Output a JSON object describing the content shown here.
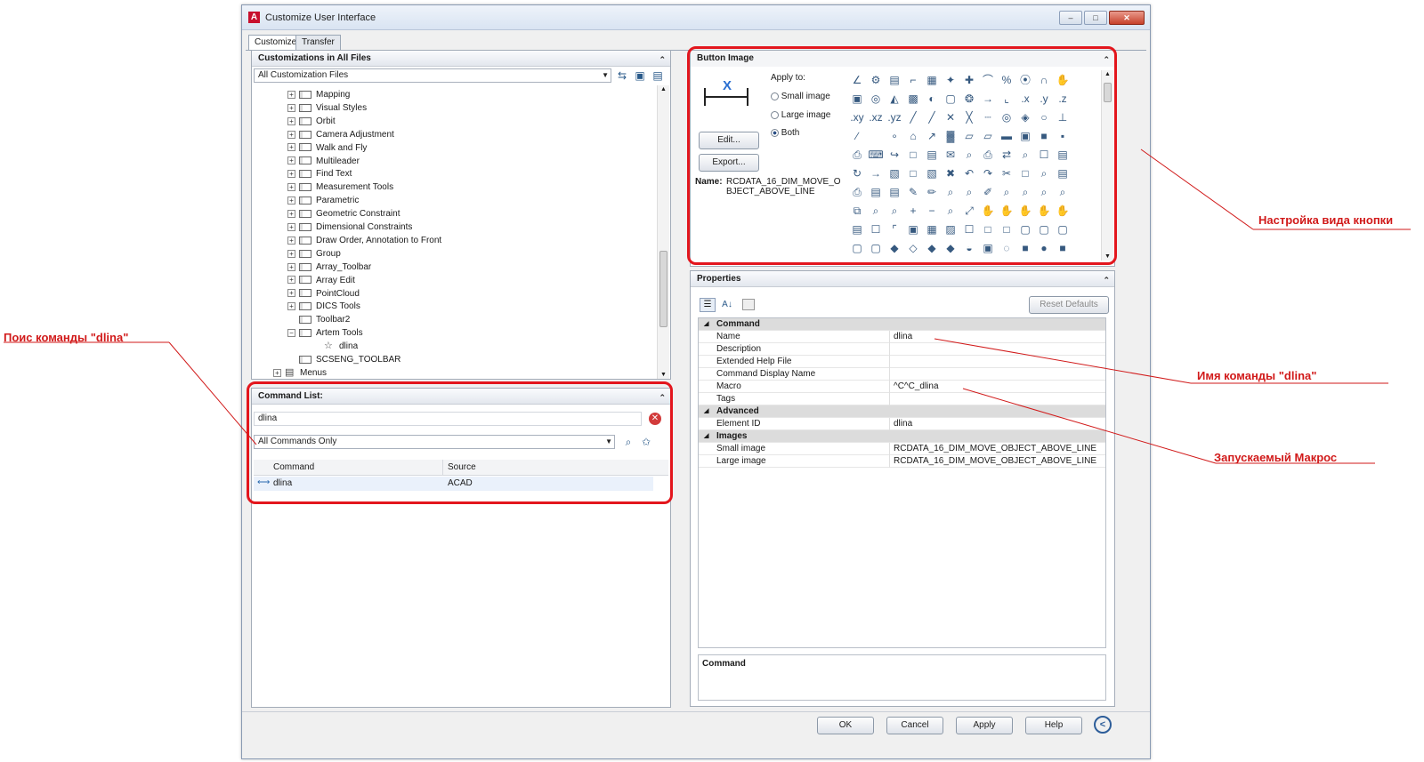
{
  "window": {
    "title": "Customize User Interface",
    "logo": "A",
    "controls": [
      "–",
      "□",
      "✕"
    ]
  },
  "tabs": [
    "Customize",
    "Transfer"
  ],
  "customizations": {
    "header": "Customizations in All Files",
    "file_combo": "All Customization Files",
    "tree": [
      {
        "label": "Mapping",
        "level": 2,
        "expander": "+"
      },
      {
        "label": "Visual Styles",
        "level": 2,
        "expander": "+"
      },
      {
        "label": "Orbit",
        "level": 2,
        "expander": "+"
      },
      {
        "label": "Camera Adjustment",
        "level": 2,
        "expander": "+"
      },
      {
        "label": "Walk and Fly",
        "level": 2,
        "expander": "+"
      },
      {
        "label": "Multileader",
        "level": 2,
        "expander": "+"
      },
      {
        "label": "Find Text",
        "level": 2,
        "expander": "+"
      },
      {
        "label": "Measurement Tools",
        "level": 2,
        "expander": "+"
      },
      {
        "label": "Parametric",
        "level": 2,
        "expander": "+"
      },
      {
        "label": "Geometric Constraint",
        "level": 2,
        "expander": "+"
      },
      {
        "label": "Dimensional Constraints",
        "level": 2,
        "expander": "+"
      },
      {
        "label": "Draw Order, Annotation to Front",
        "level": 2,
        "expander": "+"
      },
      {
        "label": "Group",
        "level": 2,
        "expander": "+"
      },
      {
        "label": "Array_Toolbar",
        "level": 2,
        "expander": "+"
      },
      {
        "label": "Array Edit",
        "level": 2,
        "expander": "+"
      },
      {
        "label": "PointCloud",
        "level": 2,
        "expander": "+"
      },
      {
        "label": "DICS Tools",
        "level": 2,
        "expander": "+"
      },
      {
        "label": "Toolbar2",
        "level": 2,
        "expander": ""
      },
      {
        "label": "Artem Tools",
        "level": 2,
        "expander": "−"
      },
      {
        "label": "dlina",
        "level": 3,
        "expander": ""
      },
      {
        "label": "SCSENG_TOOLBAR",
        "level": 2,
        "expander": ""
      },
      {
        "label": "Menus",
        "level": 1,
        "expander": "+"
      }
    ]
  },
  "command_list": {
    "header": "Command List:",
    "search_value": "dlina",
    "filter_combo": "All Commands Only",
    "columns": [
      "Command",
      "Source"
    ],
    "rows": [
      {
        "command": "dlina",
        "source": "ACAD"
      }
    ]
  },
  "button_image": {
    "header": "Button Image",
    "apply_to_label": "Apply to:",
    "options": [
      "Small image",
      "Large image",
      "Both"
    ],
    "selected": "Both",
    "edit_button": "Edit...",
    "export_button": "Export...",
    "name_label": "Name:",
    "name_value": "RCDATA_16_DIM_MOVE_OBJECT_ABOVE_LINE",
    "icons": [
      "∠",
      "⚙",
      "▤",
      "⌐",
      "▦",
      "✦",
      "✚",
      "⌒",
      "%",
      "⦿",
      "∩",
      "✋",
      "▣",
      "◎",
      "◭",
      "▩",
      "◐",
      "▢",
      "❂",
      "→",
      "⌞",
      ".x",
      ".y",
      ".z",
      ".xy",
      ".xz",
      ".yz",
      "╱",
      "╱",
      "✕",
      "╳",
      "┈",
      "◎",
      "◈",
      "○",
      "⊥",
      "∕",
      "",
      "∘",
      "⌂",
      "↗",
      "▓",
      "▱",
      "▱",
      "▬",
      "▣",
      "■",
      "▪",
      "⎙",
      "⌨",
      "↪",
      "□",
      "▤",
      "✉",
      "⌕",
      "⎙",
      "⇄",
      "⌕",
      "☐",
      "▤",
      "↻",
      "→",
      "▧",
      "□",
      "▧",
      "✖",
      "↶",
      "↷",
      "✂",
      "□",
      "⌕",
      "▤",
      "⎙",
      "▤",
      "▤",
      "✎",
      "✏",
      "⌕",
      "⌕",
      "✐",
      "⌕",
      "⌕",
      "⌕",
      "⌕",
      "⧉",
      "⌕",
      "⌕",
      "+",
      "−",
      "⌕",
      "⤢",
      "✋",
      "✋",
      "✋",
      "✋",
      "✋",
      "▤",
      "☐",
      "⌜",
      "▣",
      "▦",
      "▨",
      "☐",
      "□",
      "□",
      "▢",
      "▢",
      "▢",
      "▢",
      "▢",
      "◆",
      "◇",
      "◆",
      "◆",
      "◒",
      "▣",
      "◌",
      "■",
      "●",
      "■",
      "●",
      "◡"
    ]
  },
  "properties": {
    "header": "Properties",
    "reset_button": "Reset Defaults",
    "sections": [
      {
        "title": "Command",
        "rows": [
          {
            "key": "Name",
            "value": "dlina"
          },
          {
            "key": "Description",
            "value": ""
          },
          {
            "key": "Extended Help File",
            "value": ""
          },
          {
            "key": "Command Display Name",
            "value": ""
          },
          {
            "key": "Macro",
            "value": "^C^C_dlina"
          },
          {
            "key": "Tags",
            "value": ""
          }
        ]
      },
      {
        "title": "Advanced",
        "rows": [
          {
            "key": "Element ID",
            "value": "dlina"
          }
        ]
      },
      {
        "title": "Images",
        "rows": [
          {
            "key": "Small image",
            "value": "RCDATA_16_DIM_MOVE_OBJECT_ABOVE_LINE"
          },
          {
            "key": "Large image",
            "value": "RCDATA_16_DIM_MOVE_OBJECT_ABOVE_LINE"
          }
        ]
      }
    ],
    "description_title": "Command"
  },
  "footer": {
    "ok": "OK",
    "cancel": "Cancel",
    "apply": "Apply",
    "help": "Help"
  },
  "annotations": {
    "search": "Поис команды \"dlina\"",
    "button_view": "Настройка вида кнопки",
    "command_name": "Имя команды \"dlina\"",
    "macro": "Запускаемый Макрос"
  },
  "colors": {
    "annotation": "#e3161d",
    "annotation_text": "#d11a1a"
  }
}
